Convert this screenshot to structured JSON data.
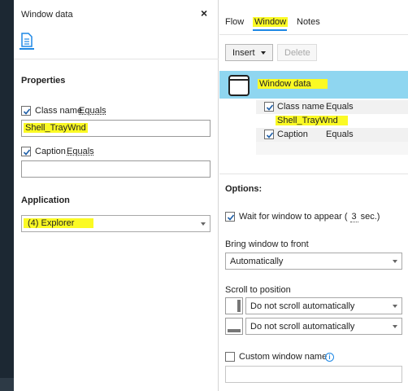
{
  "left_panel": {
    "title": "Window data",
    "close_glyph": "×",
    "tab_icon": "document-icon",
    "properties_heading": "Properties",
    "class_name": {
      "label": "Class name",
      "operator": "Equals",
      "checked": true,
      "value": "Shell_TrayWnd"
    },
    "caption": {
      "label": "Caption",
      "operator": "Equals",
      "checked": true,
      "value": ""
    },
    "application_heading": "Application",
    "application_value": "(4) Explorer"
  },
  "right_panel": {
    "tabs": [
      "Flow",
      "Window",
      "Notes"
    ],
    "active_tab": "Window",
    "insert_label": "Insert",
    "delete_label": "Delete",
    "tree": {
      "root_label": "Window data",
      "class_name_label": "Class name",
      "class_name_operator": "Equals",
      "class_name_value": "Shell_TrayWnd",
      "caption_label": "Caption",
      "caption_operator": "Equals"
    },
    "options_heading": "Options:",
    "wait_label_before": "Wait for window to appear (",
    "wait_seconds": "3",
    "wait_label_after": "sec.)",
    "bring_front_label": "Bring window to front",
    "bring_front_value": "Automatically",
    "scroll_label": "Scroll to position",
    "scroll_vertical_value": "Do not scroll automatically",
    "scroll_horizontal_value": "Do not scroll automatically",
    "custom_name_label": "Custom window name",
    "custom_name_value": ""
  },
  "colors": {
    "highlight": "#fbfa24",
    "selection": "#8fd6f0",
    "accent": "#1e88e5",
    "sidebar_dark": "#1c2833"
  }
}
